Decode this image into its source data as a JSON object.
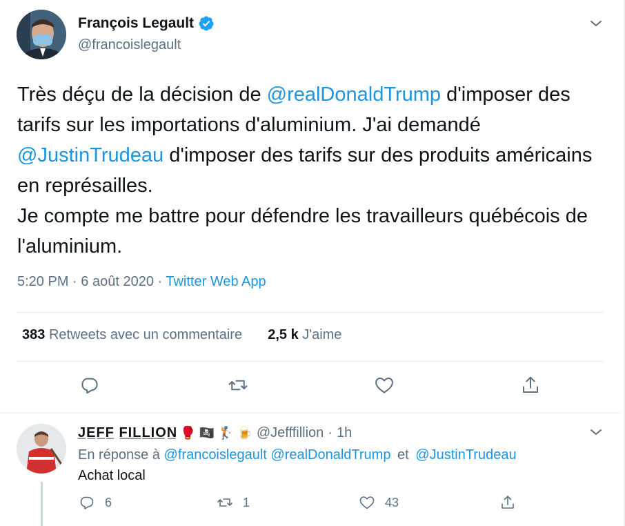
{
  "tweet": {
    "author_name": "François Legault",
    "author_handle": "@francoislegault",
    "text": {
      "seg1": "Très déçu de la décision de ",
      "mention1": "@realDonaldTrump",
      "seg2": " d'imposer des tarifs sur les importations d'aluminium. J'ai demandé ",
      "mention2": "@JustinTrudeau",
      "seg3": " d'imposer des tarifs sur des produits américains en représailles.",
      "seg4": "Je compte me battre pour défendre les travailleurs québécois de l'aluminium."
    },
    "time": "5:20 PM",
    "dot1": "·",
    "date": "6 août 2020",
    "dot2": "·",
    "source": "Twitter Web App",
    "stats": {
      "retweets_count": "383",
      "retweets_label": "Retweets avec un commentaire",
      "likes_count": "2,5 k",
      "likes_label": "J'aime"
    },
    "icons": [
      "reply-icon",
      "retweet-icon",
      "like-icon",
      "share-icon"
    ]
  },
  "reply": {
    "author_name": "J̲E̲F̲F̲ F̲I̲L̲L̲I̲O̲N̲",
    "emojis": "🥊 🏴‍☠️ 🏌 🍺",
    "author_handle": "@Jefffillion",
    "dot": "·",
    "time": "1h",
    "replying_prefix": "En réponse à",
    "replying_to_1": "@francoislegault",
    "replying_to_2": "@realDonaldTrump",
    "replying_and": "et",
    "replying_to_3": "@JustinTrudeau",
    "text": "Achat local",
    "reply_count": "6",
    "retweet_count": "1",
    "like_count": "43"
  },
  "colors": {
    "accent": "#1b95e0",
    "secondary_text": "#5b7083",
    "primary_text": "#0f1419",
    "divider": "#ebeef0"
  }
}
